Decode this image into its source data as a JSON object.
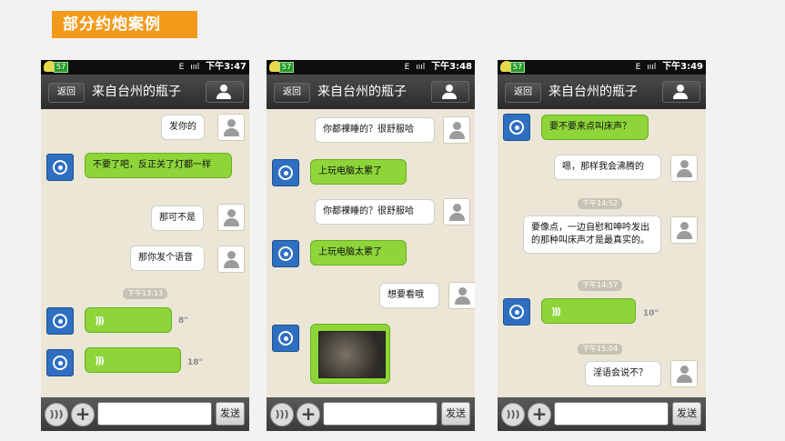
{
  "banner": "部分约炮案例",
  "phones": [
    {
      "time": "下午3:47",
      "status_badge": "57",
      "network": "E",
      "signal": "ıııl",
      "back": "返回",
      "title": "来自台州的瓶子",
      "send": "发送",
      "messages": {
        "m1": "发你的",
        "m2": "不要了吧，反正关了灯都一样",
        "m3": "那可不是",
        "m4": "那你发个语音",
        "ts1": "下午13:13",
        "d1": "8\"",
        "d2": "18\""
      }
    },
    {
      "time": "下午3:48",
      "status_badge": "57",
      "network": "E",
      "signal": "ıııl",
      "back": "返回",
      "title": "来自台州的瓶子",
      "send": "发送",
      "messages": {
        "m1": "你都裸睡的？很舒服哈",
        "m2": "上玩电脑太累了",
        "m3": "你都裸睡的？很舒服哈",
        "m4": "上玩电脑太累了",
        "m5": "想要看哦"
      }
    },
    {
      "time": "下午3:49",
      "status_badge": "57",
      "network": "E",
      "signal": "ıııl",
      "back": "返回",
      "title": "来自台州的瓶子",
      "send": "发送",
      "messages": {
        "m1": "要不要来点叫床声？",
        "m2": "嗯，那样我会沸腾的",
        "ts1": "下午14:52",
        "m3": "要像点，一边自慰和呻吟发出的那种叫床声才是最真实的。",
        "ts2": "下午14:57",
        "d1": "10\"",
        "ts3": "下午15:04",
        "m4": "淫语会说不？"
      }
    }
  ]
}
